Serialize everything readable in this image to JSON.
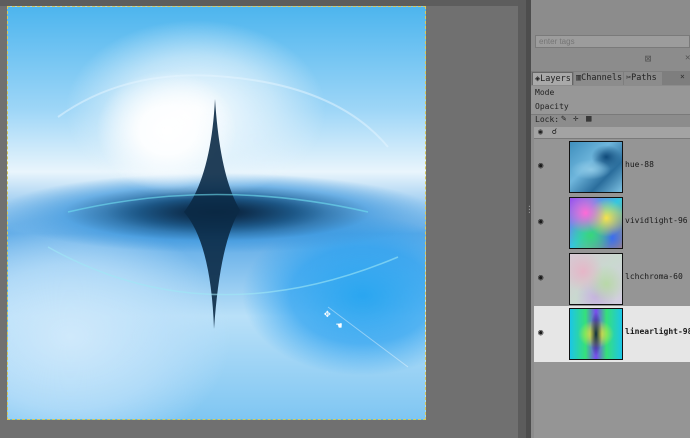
{
  "canvas": {
    "cursor_icon": "move-cursor-icon",
    "hand_icon": "hand-icon"
  },
  "tags": {
    "placeholder": "enter tags",
    "clear_icon": "x-icon"
  },
  "tabs": [
    {
      "label": "Layers",
      "icon": "layers-icon"
    },
    {
      "label": "Channels",
      "icon": "channels-icon"
    },
    {
      "label": "Paths",
      "icon": "paths-icon"
    }
  ],
  "mode_label": "Mode",
  "opacity_label": "Opacity",
  "lock_label": "Lock:",
  "lock_icons": [
    "brush-icon",
    "move-icon",
    "checker-icon"
  ],
  "layers": [
    {
      "name": "hue-88",
      "visible": true,
      "selected": false
    },
    {
      "name": "vividlight-96",
      "visible": true,
      "selected": false
    },
    {
      "name": "lchchroma-60",
      "visible": true,
      "selected": false
    },
    {
      "name": "linearlight-98",
      "visible": true,
      "selected": true
    }
  ]
}
